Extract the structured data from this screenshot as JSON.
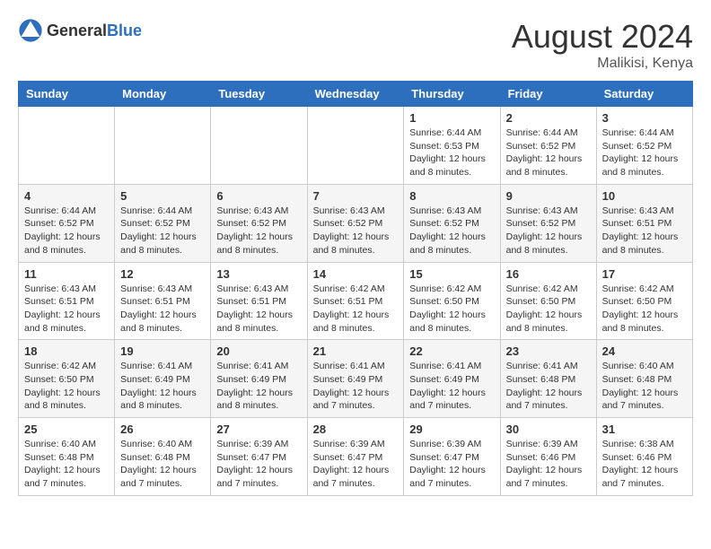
{
  "header": {
    "logo": {
      "general": "General",
      "blue": "Blue"
    },
    "title": "August 2024",
    "location": "Malikisi, Kenya"
  },
  "weekdays": [
    "Sunday",
    "Monday",
    "Tuesday",
    "Wednesday",
    "Thursday",
    "Friday",
    "Saturday"
  ],
  "weeks": [
    [
      null,
      null,
      null,
      null,
      {
        "day": 1,
        "sunrise": "Sunrise: 6:44 AM",
        "sunset": "Sunset: 6:53 PM",
        "daylight": "Daylight: 12 hours and 8 minutes."
      },
      {
        "day": 2,
        "sunrise": "Sunrise: 6:44 AM",
        "sunset": "Sunset: 6:52 PM",
        "daylight": "Daylight: 12 hours and 8 minutes."
      },
      {
        "day": 3,
        "sunrise": "Sunrise: 6:44 AM",
        "sunset": "Sunset: 6:52 PM",
        "daylight": "Daylight: 12 hours and 8 minutes."
      }
    ],
    [
      {
        "day": 4,
        "sunrise": "Sunrise: 6:44 AM",
        "sunset": "Sunset: 6:52 PM",
        "daylight": "Daylight: 12 hours and 8 minutes."
      },
      {
        "day": 5,
        "sunrise": "Sunrise: 6:44 AM",
        "sunset": "Sunset: 6:52 PM",
        "daylight": "Daylight: 12 hours and 8 minutes."
      },
      {
        "day": 6,
        "sunrise": "Sunrise: 6:43 AM",
        "sunset": "Sunset: 6:52 PM",
        "daylight": "Daylight: 12 hours and 8 minutes."
      },
      {
        "day": 7,
        "sunrise": "Sunrise: 6:43 AM",
        "sunset": "Sunset: 6:52 PM",
        "daylight": "Daylight: 12 hours and 8 minutes."
      },
      {
        "day": 8,
        "sunrise": "Sunrise: 6:43 AM",
        "sunset": "Sunset: 6:52 PM",
        "daylight": "Daylight: 12 hours and 8 minutes."
      },
      {
        "day": 9,
        "sunrise": "Sunrise: 6:43 AM",
        "sunset": "Sunset: 6:52 PM",
        "daylight": "Daylight: 12 hours and 8 minutes."
      },
      {
        "day": 10,
        "sunrise": "Sunrise: 6:43 AM",
        "sunset": "Sunset: 6:51 PM",
        "daylight": "Daylight: 12 hours and 8 minutes."
      }
    ],
    [
      {
        "day": 11,
        "sunrise": "Sunrise: 6:43 AM",
        "sunset": "Sunset: 6:51 PM",
        "daylight": "Daylight: 12 hours and 8 minutes."
      },
      {
        "day": 12,
        "sunrise": "Sunrise: 6:43 AM",
        "sunset": "Sunset: 6:51 PM",
        "daylight": "Daylight: 12 hours and 8 minutes."
      },
      {
        "day": 13,
        "sunrise": "Sunrise: 6:43 AM",
        "sunset": "Sunset: 6:51 PM",
        "daylight": "Daylight: 12 hours and 8 minutes."
      },
      {
        "day": 14,
        "sunrise": "Sunrise: 6:42 AM",
        "sunset": "Sunset: 6:51 PM",
        "daylight": "Daylight: 12 hours and 8 minutes."
      },
      {
        "day": 15,
        "sunrise": "Sunrise: 6:42 AM",
        "sunset": "Sunset: 6:50 PM",
        "daylight": "Daylight: 12 hours and 8 minutes."
      },
      {
        "day": 16,
        "sunrise": "Sunrise: 6:42 AM",
        "sunset": "Sunset: 6:50 PM",
        "daylight": "Daylight: 12 hours and 8 minutes."
      },
      {
        "day": 17,
        "sunrise": "Sunrise: 6:42 AM",
        "sunset": "Sunset: 6:50 PM",
        "daylight": "Daylight: 12 hours and 8 minutes."
      }
    ],
    [
      {
        "day": 18,
        "sunrise": "Sunrise: 6:42 AM",
        "sunset": "Sunset: 6:50 PM",
        "daylight": "Daylight: 12 hours and 8 minutes."
      },
      {
        "day": 19,
        "sunrise": "Sunrise: 6:41 AM",
        "sunset": "Sunset: 6:49 PM",
        "daylight": "Daylight: 12 hours and 8 minutes."
      },
      {
        "day": 20,
        "sunrise": "Sunrise: 6:41 AM",
        "sunset": "Sunset: 6:49 PM",
        "daylight": "Daylight: 12 hours and 8 minutes."
      },
      {
        "day": 21,
        "sunrise": "Sunrise: 6:41 AM",
        "sunset": "Sunset: 6:49 PM",
        "daylight": "Daylight: 12 hours and 7 minutes."
      },
      {
        "day": 22,
        "sunrise": "Sunrise: 6:41 AM",
        "sunset": "Sunset: 6:49 PM",
        "daylight": "Daylight: 12 hours and 7 minutes."
      },
      {
        "day": 23,
        "sunrise": "Sunrise: 6:41 AM",
        "sunset": "Sunset: 6:48 PM",
        "daylight": "Daylight: 12 hours and 7 minutes."
      },
      {
        "day": 24,
        "sunrise": "Sunrise: 6:40 AM",
        "sunset": "Sunset: 6:48 PM",
        "daylight": "Daylight: 12 hours and 7 minutes."
      }
    ],
    [
      {
        "day": 25,
        "sunrise": "Sunrise: 6:40 AM",
        "sunset": "Sunset: 6:48 PM",
        "daylight": "Daylight: 12 hours and 7 minutes."
      },
      {
        "day": 26,
        "sunrise": "Sunrise: 6:40 AM",
        "sunset": "Sunset: 6:48 PM",
        "daylight": "Daylight: 12 hours and 7 minutes."
      },
      {
        "day": 27,
        "sunrise": "Sunrise: 6:39 AM",
        "sunset": "Sunset: 6:47 PM",
        "daylight": "Daylight: 12 hours and 7 minutes."
      },
      {
        "day": 28,
        "sunrise": "Sunrise: 6:39 AM",
        "sunset": "Sunset: 6:47 PM",
        "daylight": "Daylight: 12 hours and 7 minutes."
      },
      {
        "day": 29,
        "sunrise": "Sunrise: 6:39 AM",
        "sunset": "Sunset: 6:47 PM",
        "daylight": "Daylight: 12 hours and 7 minutes."
      },
      {
        "day": 30,
        "sunrise": "Sunrise: 6:39 AM",
        "sunset": "Sunset: 6:46 PM",
        "daylight": "Daylight: 12 hours and 7 minutes."
      },
      {
        "day": 31,
        "sunrise": "Sunrise: 6:38 AM",
        "sunset": "Sunset: 6:46 PM",
        "daylight": "Daylight: 12 hours and 7 minutes."
      }
    ]
  ]
}
